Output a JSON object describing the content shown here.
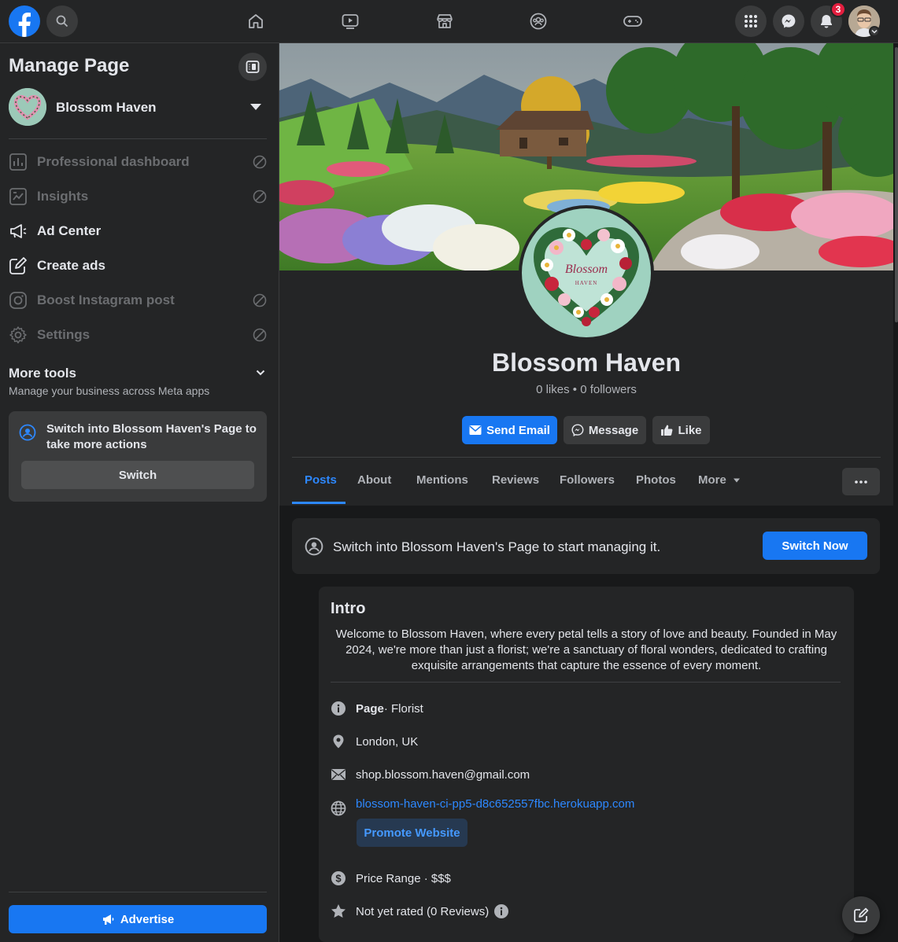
{
  "topbar": {
    "notification_count": "3"
  },
  "sidebar": {
    "title": "Manage Page",
    "page_name": "Blossom Haven",
    "items": [
      {
        "label": "Professional dashboard",
        "icon": "chart-icon",
        "disabled": true
      },
      {
        "label": "Insights",
        "icon": "insights-icon",
        "disabled": true
      },
      {
        "label": "Ad Center",
        "icon": "megaphone-icon",
        "disabled": false
      },
      {
        "label": "Create ads",
        "icon": "edit-icon",
        "disabled": false
      },
      {
        "label": "Boost Instagram post",
        "icon": "instagram-icon",
        "disabled": true
      },
      {
        "label": "Settings",
        "icon": "gear-icon",
        "disabled": true
      }
    ],
    "more_tools_title": "More tools",
    "more_tools_subtitle": "Manage your business across Meta apps",
    "switch_card_text": "Switch into Blossom Haven's Page to take more actions",
    "switch_button": "Switch",
    "advertise_button": "Advertise"
  },
  "profile": {
    "logo_text_1": "Blossom",
    "logo_text_2": "HAVEN",
    "name": "Blossom Haven",
    "stats": "0 likes • 0 followers",
    "actions": {
      "send_email": "Send Email",
      "message": "Message",
      "like": "Like"
    },
    "tabs": [
      "Posts",
      "About",
      "Mentions",
      "Reviews",
      "Followers",
      "Photos",
      "More"
    ]
  },
  "banner": {
    "text": "Switch into Blossom Haven's Page to start managing it.",
    "button": "Switch Now"
  },
  "intro": {
    "title": "Intro",
    "description": "Welcome to Blossom Haven, where every petal tells a story of love and beauty. Founded in May 2024, we're more than just a florist; we're a sanctuary of floral wonders, dedicated to crafting exquisite arrangements that capture the essence of every moment.",
    "page_type_label": "Page",
    "page_type_value": " · Florist",
    "location": "London, UK",
    "email": "shop.blossom.haven@gmail.com",
    "website": "blossom-haven-ci-pp5-d8c652557fbc.herokuapp.com",
    "promote_button": "Promote Website",
    "price_range": "Price Range · $$$",
    "rating": "Not yet rated (0 Reviews)"
  },
  "colors": {
    "accent": "#1877f2",
    "link": "#2d88ff",
    "background": "#18191a",
    "card": "#242526"
  }
}
